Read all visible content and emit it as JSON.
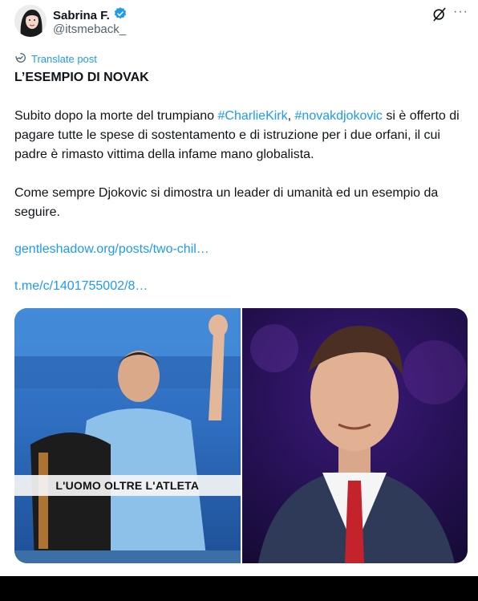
{
  "author": {
    "name": "Sabrina F.",
    "handle": "@itsmeback_",
    "verified": true
  },
  "actions": {
    "grok_icon": "grok-icon",
    "more_label": "···"
  },
  "translate_label": "Translate post",
  "post": {
    "heading": "L’ESEMPIO DI NOVAK",
    "p1_a": "Subito dopo la morte del trumpiano ",
    "p1_tag1": "#CharlieKirk",
    "p1_b": ", ",
    "p1_tag2": "#novakdjokovic",
    "p1_c": " si è offerto di pagare tutte le spese di sostentamento e di istruzione per i due orfani, il cui padre è rimasto vittima della infame mano globalista.",
    "p2": "Come sempre Djokovic si dimostra un leader di umanità ed un esempio da seguire.",
    "link1": "gentleshadow.org/posts/two-chil…",
    "link2": "t.me/c/1401755002/8…"
  },
  "media": {
    "left_caption": "L'UOMO OLTRE L'ATLETA"
  },
  "colors": {
    "link": "#1d9bf0",
    "verified": "#1d9bf0"
  }
}
